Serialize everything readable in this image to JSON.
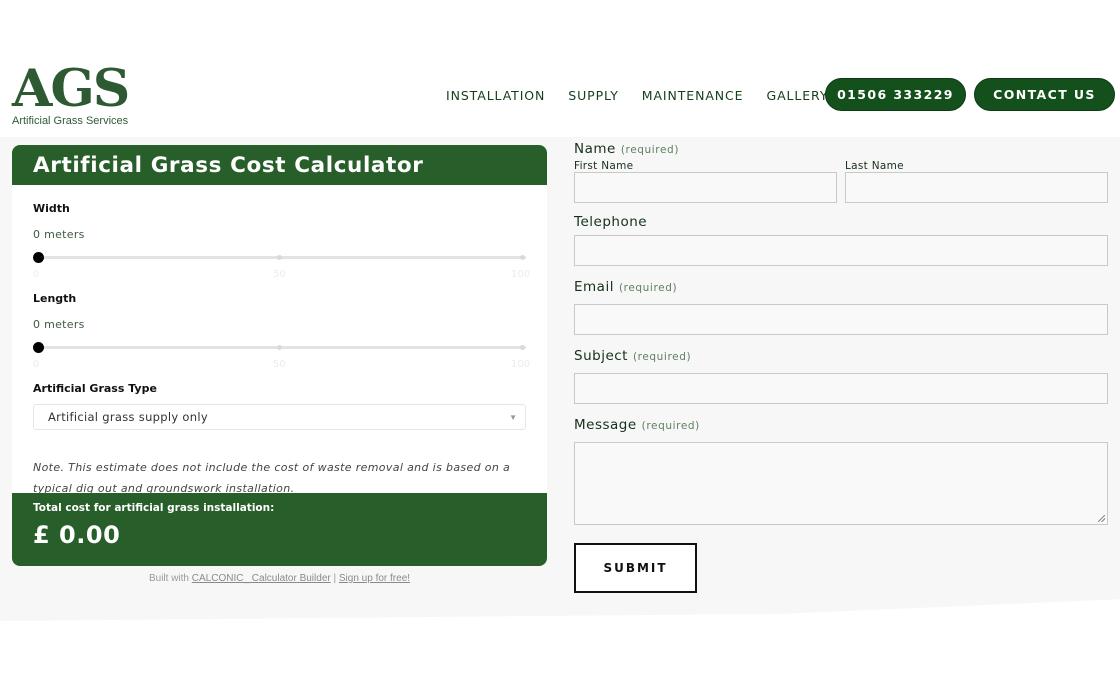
{
  "header": {
    "logo": {
      "mark": "AGS",
      "subtitle": "Artificial Grass Services"
    },
    "nav": [
      {
        "label": "INSTALLATION"
      },
      {
        "label": "SUPPLY"
      },
      {
        "label": "MAINTENANCE"
      },
      {
        "label": "GALLERY"
      }
    ],
    "phone_button": "01506 333229",
    "contact_button": "CONTACT US",
    "colors": {
      "brand_green": "#13501b",
      "logo_green": "#2e5a33"
    }
  },
  "calculator": {
    "title": "Artificial Grass Cost Calculator",
    "width": {
      "label": "Width",
      "value_text": "0 meters",
      "value": 0,
      "min": 0,
      "max": 100,
      "ticks": [
        "0",
        "50",
        "100"
      ]
    },
    "length": {
      "label": "Length",
      "value_text": "0 meters",
      "value": 0,
      "min": 0,
      "max": 100,
      "ticks": [
        "0",
        "50",
        "100"
      ]
    },
    "grass_type": {
      "label": "Artificial Grass Type",
      "selected": "Artificial grass supply only"
    },
    "note": "Note. This estimate does not include the cost of waste removal and is based on a typical dig out and groundswork installation.",
    "total_label": "Total cost for artificial grass installation:",
    "total_value": "£ 0.00",
    "colors": {
      "header_green": "#285e2a"
    }
  },
  "builtwith": {
    "prefix": "Built with ",
    "link1": "CALCONIC_ Calculator Builder",
    "sep": " | ",
    "link2": "Sign up for free!"
  },
  "form": {
    "name": {
      "label": "Name",
      "required": "(required)",
      "first": "First Name",
      "last": "Last Name",
      "first_value": "",
      "last_value": ""
    },
    "telephone": {
      "label": "Telephone",
      "value": ""
    },
    "email": {
      "label": "Email",
      "required": "(required)",
      "value": ""
    },
    "subject": {
      "label": "Subject",
      "required": "(required)",
      "value": ""
    },
    "message": {
      "label": "Message",
      "required": "(required)",
      "value": ""
    },
    "submit": "SUBMIT"
  }
}
